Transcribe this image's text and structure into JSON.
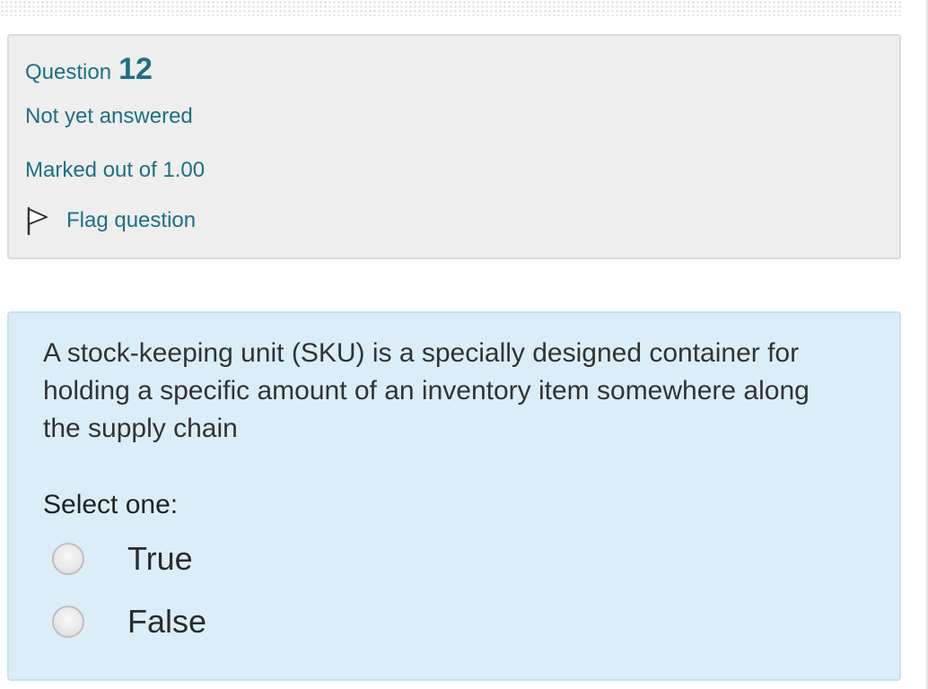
{
  "question_info": {
    "question_word": "Question",
    "question_number": "12",
    "state": "Not yet answered",
    "grade": "Marked out of 1.00",
    "flag_label": "Flag question",
    "accent_color": "#1f6f86",
    "icon": "flag-icon"
  },
  "question": {
    "text": "A stock-keeping unit (SKU) is a specially designed container for holding a specific amount of an inventory item somewhere along the supply chain",
    "prompt": "Select one:",
    "options": [
      {
        "label": "True",
        "selected": false
      },
      {
        "label": "False",
        "selected": false
      }
    ],
    "panel_color": "#dbeef7"
  }
}
